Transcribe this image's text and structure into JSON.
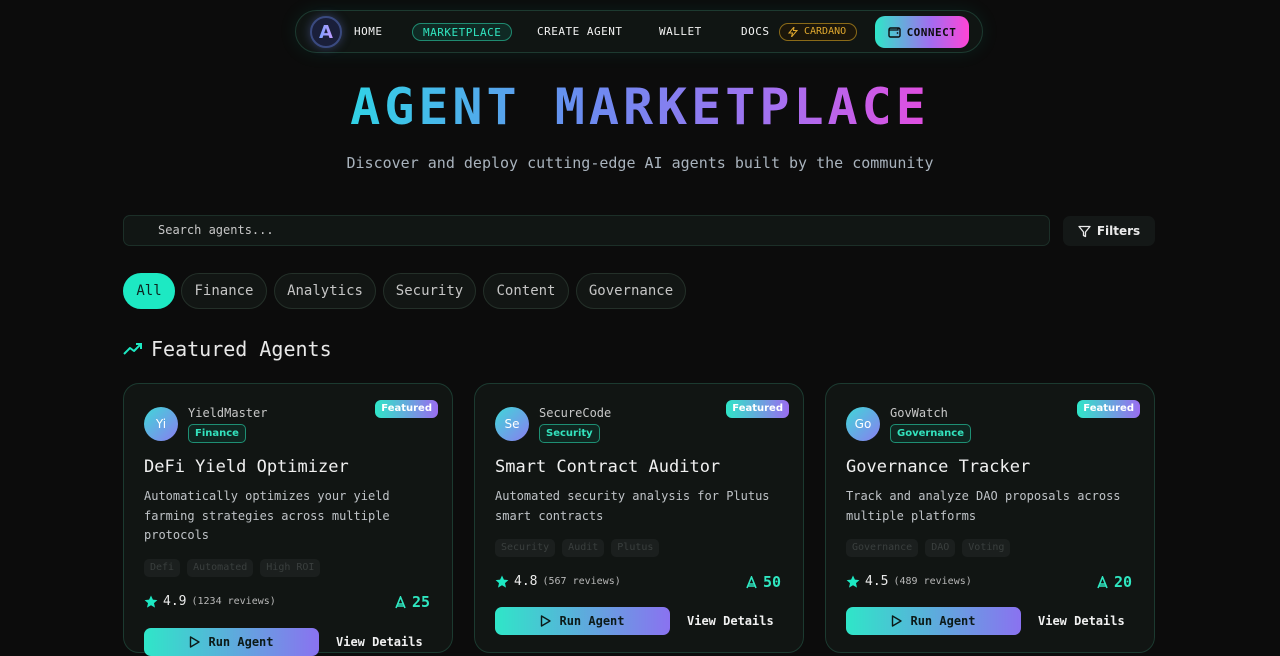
{
  "nav": {
    "logo_letter": "A",
    "items": [
      "HOME",
      "MARKETPLACE",
      "CREATE AGENT",
      "WALLET",
      "DOCS"
    ],
    "active": "MARKETPLACE",
    "network": "CARDANO",
    "connect_label": "CONNECT"
  },
  "hero": {
    "title": "AGENT MARKETPLACE",
    "subtitle": "Discover and deploy cutting-edge AI agents built by the community"
  },
  "search": {
    "placeholder": "Search agents...",
    "filters_label": "Filters"
  },
  "categories": [
    "All",
    "Finance",
    "Analytics",
    "Security",
    "Content",
    "Governance"
  ],
  "active_category": "All",
  "section": {
    "title": "Featured Agents"
  },
  "cards": [
    {
      "avatar": "Yi",
      "author": "YieldMaster",
      "category": "Finance",
      "badge": "Featured",
      "title": "DeFi Yield Optimizer",
      "description": "Automatically optimizes your yield farming strategies across multiple protocols",
      "tags": [
        "Defi",
        "Automated",
        "High ROI"
      ],
      "rating": "4.9",
      "reviews": "(1234 reviews)",
      "cost": "25",
      "run_label": "Run Agent",
      "details_label": "View Details"
    },
    {
      "avatar": "Se",
      "author": "SecureCode",
      "category": "Security",
      "badge": "Featured",
      "title": "Smart Contract Auditor",
      "description": "Automated security analysis for Plutus smart contracts",
      "tags": [
        "Security",
        "Audit",
        "Plutus"
      ],
      "rating": "4.8",
      "reviews": "(567 reviews)",
      "cost": "50",
      "run_label": "Run Agent",
      "details_label": "View Details"
    },
    {
      "avatar": "Go",
      "author": "GovWatch",
      "category": "Governance",
      "badge": "Featured",
      "title": "Governance Tracker",
      "description": "Track and analyze DAO proposals across multiple platforms",
      "tags": [
        "Governance",
        "DAO",
        "Voting"
      ],
      "rating": "4.5",
      "reviews": "(489 reviews)",
      "cost": "20",
      "run_label": "Run Agent",
      "details_label": "View Details"
    }
  ],
  "colors": {
    "accent": "#1de9c3",
    "purple": "#9a6cf0",
    "pink": "#ff45d6",
    "background": "#0c0c0c",
    "cardano": "#e0a82e"
  }
}
